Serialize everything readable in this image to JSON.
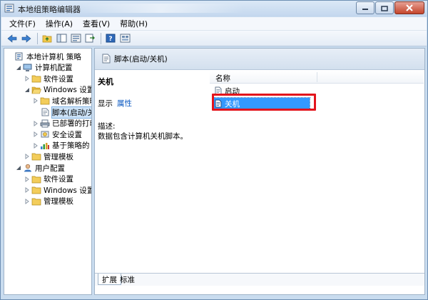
{
  "window": {
    "title": "本地组策略编辑器"
  },
  "menubar": {
    "items": [
      "文件(F)",
      "操作(A)",
      "查看(V)",
      "帮助(H)"
    ]
  },
  "tree": {
    "items": [
      {
        "label": "本地计算机 策略",
        "icon": "computer-policy-icon",
        "level": 0,
        "expander": "none"
      },
      {
        "label": "计算机配置",
        "icon": "computer-config-icon",
        "level": 1,
        "expander": "expanded"
      },
      {
        "label": "软件设置",
        "icon": "folder-icon",
        "level": 2,
        "expander": "collapsed"
      },
      {
        "label": "Windows 设置",
        "icon": "folder-open-icon",
        "level": 2,
        "expander": "expanded"
      },
      {
        "label": "域名解析策略",
        "icon": "folder-icon",
        "level": 3,
        "expander": "collapsed"
      },
      {
        "label": "脚本(启动/关",
        "icon": "script-icon",
        "level": 3,
        "expander": "none",
        "selected": true
      },
      {
        "label": "已部署的打印",
        "icon": "printer-icon",
        "level": 3,
        "expander": "collapsed"
      },
      {
        "label": "安全设置",
        "icon": "security-icon",
        "level": 3,
        "expander": "collapsed"
      },
      {
        "label": "基于策略的 Q",
        "icon": "qos-chart-icon",
        "level": 3,
        "expander": "collapsed"
      },
      {
        "label": "管理模板",
        "icon": "folder-icon",
        "level": 2,
        "expander": "collapsed"
      },
      {
        "label": "用户配置",
        "icon": "user-config-icon",
        "level": 1,
        "expander": "expanded"
      },
      {
        "label": "软件设置",
        "icon": "folder-icon",
        "level": 2,
        "expander": "collapsed"
      },
      {
        "label": "Windows 设置",
        "icon": "folder-icon",
        "level": 2,
        "expander": "collapsed"
      },
      {
        "label": "管理模板",
        "icon": "folder-icon",
        "level": 2,
        "expander": "collapsed"
      }
    ]
  },
  "details": {
    "header_title": "脚本(启动/关机)",
    "heading": "关机",
    "show_label": "显示",
    "properties_link": "属性",
    "description_label": "描述:",
    "description_text": "数据包含计算机关机脚本。"
  },
  "list": {
    "column_name": "名称",
    "items": [
      {
        "label": "启动",
        "selected": false
      },
      {
        "label": "关机",
        "selected": true
      }
    ]
  },
  "tabs": [
    "扩展",
    "标准"
  ],
  "colors": {
    "highlight": "#3399ff",
    "annotation_red": "#e3141c",
    "link": "#0a58c2"
  }
}
